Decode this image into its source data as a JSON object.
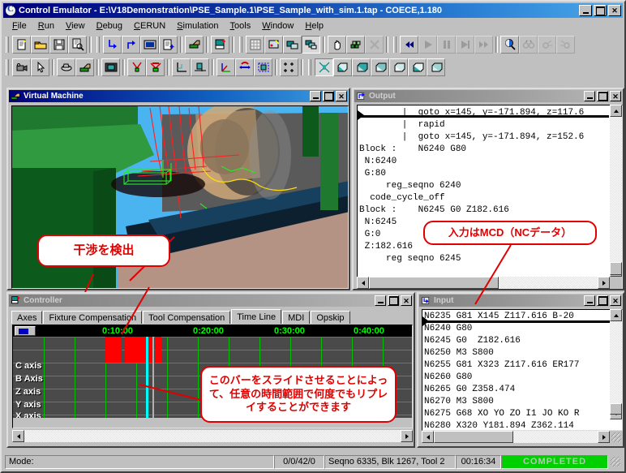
{
  "window": {
    "title": "Control Emulator - E:\\V18Demonstration\\PSE_Sample.1\\PSE_Sample_with_sim.1.tap - COECE,1.180",
    "icon": "app-icon",
    "minimize_label": "Minimize",
    "maximize_label": "Maximize",
    "close_label": "Close"
  },
  "menu": [
    {
      "label": "File",
      "accel": "F"
    },
    {
      "label": "Run",
      "accel": "R"
    },
    {
      "label": "View",
      "accel": "V"
    },
    {
      "label": "Debug",
      "accel": "D"
    },
    {
      "label": "CERUN",
      "accel": "C"
    },
    {
      "label": "Simulation",
      "accel": "S"
    },
    {
      "label": "Tools",
      "accel": "T"
    },
    {
      "label": "Window",
      "accel": "W"
    },
    {
      "label": "Help",
      "accel": "H"
    }
  ],
  "toolbar1": [
    {
      "name": "new-file-icon",
      "label": "New"
    },
    {
      "name": "open-folder-icon",
      "label": "Open"
    },
    {
      "name": "save-disk-icon",
      "label": "Save"
    },
    {
      "name": "print-preview-icon",
      "label": "Print Preview"
    },
    {
      "name": "step-into-icon",
      "label": "Step Into"
    },
    {
      "name": "step-out-icon",
      "label": "Step Out"
    },
    {
      "name": "screen-icon",
      "label": "Display"
    },
    {
      "name": "list-add-icon",
      "label": "Add Block"
    },
    {
      "name": "machine-icon",
      "label": "Machine"
    },
    {
      "name": "chart-add-icon",
      "label": "Add Chart"
    },
    {
      "name": "grid-icon",
      "label": "Grid"
    },
    {
      "name": "edit-shape-icon",
      "label": "Edit Shape"
    },
    {
      "name": "layers-icon",
      "label": "Layers"
    },
    {
      "name": "layers-alt-icon",
      "label": "Layers Alt"
    },
    {
      "name": "pan-hand-icon",
      "label": "Pan"
    },
    {
      "name": "blocks-icon",
      "label": "Blocks"
    },
    {
      "name": "clear-icon",
      "label": "Clear"
    },
    {
      "name": "rewind-icon",
      "label": "Rewind"
    },
    {
      "name": "play-icon",
      "label": "Play"
    },
    {
      "name": "pause-icon",
      "label": "Pause"
    },
    {
      "name": "step-next-icon",
      "label": "Step"
    },
    {
      "name": "fast-forward-icon",
      "label": "Fast Forward"
    },
    {
      "name": "zoom-inspect-icon",
      "label": "Inspect"
    },
    {
      "name": "binoculars-icon",
      "label": "Find"
    },
    {
      "name": "find-next-icon",
      "label": "Find Next"
    },
    {
      "name": "find-prev-icon",
      "label": "Find Previous"
    }
  ],
  "toolbar2": [
    {
      "name": "camera-icon",
      "label": "Camera"
    },
    {
      "name": "cursor-arrow-icon",
      "label": "Select"
    },
    {
      "name": "part-icon",
      "label": "Part"
    },
    {
      "name": "machine-tool-icon",
      "label": "Machine Tool"
    },
    {
      "name": "viewport-icon",
      "label": "Viewport"
    },
    {
      "name": "tool-path-icon",
      "label": "Tool Path"
    },
    {
      "name": "tool-path2-icon",
      "label": "Tool Path 2"
    },
    {
      "name": "axis-corner-icon",
      "label": "Axis Corner"
    },
    {
      "name": "plane-view-icon",
      "label": "Plane View"
    },
    {
      "name": "axis-xyz-icon",
      "label": "XYZ Axis"
    },
    {
      "name": "rotate-icon",
      "label": "Rotate"
    },
    {
      "name": "select-box-icon",
      "label": "Select Box"
    },
    {
      "name": "crosshair-icon",
      "label": "Crosshair"
    },
    {
      "name": "iso-view-icon",
      "label": "Isometric View"
    },
    {
      "name": "view-box-1-icon",
      "label": "View 1"
    },
    {
      "name": "view-box-2-icon",
      "label": "View 2"
    },
    {
      "name": "view-box-3-icon",
      "label": "View 3"
    },
    {
      "name": "view-box-4-icon",
      "label": "View 4"
    },
    {
      "name": "view-box-5-icon",
      "label": "View 5"
    },
    {
      "name": "view-box-6-icon",
      "label": "View 6"
    }
  ],
  "virtual_machine": {
    "title": "Virtual Machine",
    "icon": "machine-icon",
    "callout": "干渉を検出"
  },
  "output": {
    "title": "Output",
    "icon": "output-icon",
    "callout": "入力はMCD（NCデータ）",
    "lines": [
      "        |  goto x=145, y=-171.894, z=117.6",
      "        |  rapid",
      "        |  goto x=145, y=-171.894, z=152.6",
      "Block :    N6240 G80",
      " N:6240",
      " G:80",
      "     reg_seqno 6240",
      "  code_cycle_off",
      "Block :    N6245 G0 Z182.616",
      " N:6245",
      " G:0",
      " Z:182.616",
      "     reg seqno 6245"
    ]
  },
  "controller": {
    "title": "Controller",
    "icon": "controller-icon",
    "tabs": [
      {
        "label": "Axes",
        "selected": false
      },
      {
        "label": "Fixture Compensation",
        "selected": false
      },
      {
        "label": "Tool Compensation",
        "selected": false
      },
      {
        "label": "Time Line",
        "selected": true
      },
      {
        "label": "MDI",
        "selected": false
      },
      {
        "label": "Opskip",
        "selected": false
      }
    ],
    "callout": "このバーをスライドさせることによって、任意の時間範囲で何度でもリプレイすることができます",
    "timeline": {
      "ticks": [
        "0:10:00",
        "0:20:00",
        "0:30:00",
        "0:40:00"
      ],
      "axes": [
        "C axis",
        "B Axis",
        "Z axis",
        "Y axis",
        "X axis"
      ],
      "tick_color": "#00ff00",
      "grid_color": "#00c000",
      "collision_color": "#ff0000",
      "cursor_color": "#00ffff"
    }
  },
  "input": {
    "title": "Input",
    "icon": "input-icon",
    "lines": [
      "N6235 G81 X145 Z117.616 B-20",
      "N6240 G80",
      "N6245 G0  Z182.616",
      "N6250 M3 S800",
      "N6255 G81 X323 Z117.616 ER177",
      "N6260 G80",
      "N6265 G0 Z358.474",
      "N6270 M3 S800",
      "N6275 G68 XO YO ZO I1 JO KO R",
      "N6280 X320 Y181.894 Z362.114"
    ]
  },
  "statusbar": {
    "mode_label": "Mode:",
    "counters": "0/0/42/0",
    "info": "Seqno 6335, Blk 1267, Tool 2",
    "elapsed": "00:16:34",
    "state": "COMPLETED",
    "state_color": "#00d000"
  }
}
